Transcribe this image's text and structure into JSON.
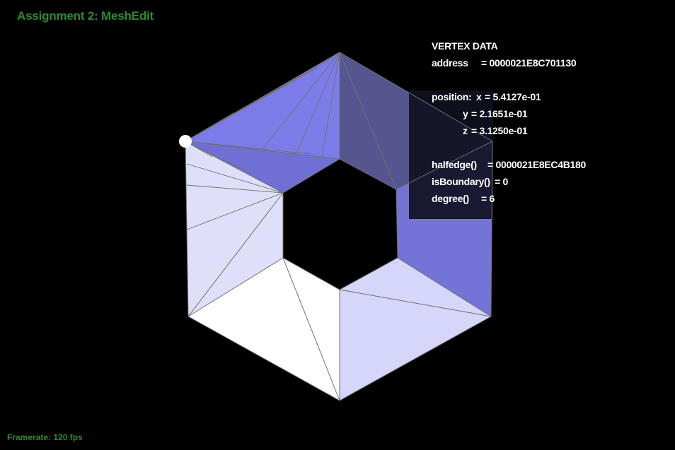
{
  "app": {
    "title": "Assignment 2: MeshEdit",
    "framerate_label": "Framerate:",
    "framerate_value": "120 fps"
  },
  "vertex_panel": {
    "heading": "VERTEX DATA",
    "address_label": "address",
    "address_value": "= 0000021E8C701130",
    "position_label": "position:",
    "x_label": "x",
    "x_value": "= 5.4127e-01",
    "y_label": "y",
    "y_value": "= 2.1651e-01",
    "z_label": "z",
    "z_value": "= 3.1250e-01",
    "halfedge_label": "halfedge()",
    "halfedge_value": "= 0000021E8EC4B180",
    "isboundary_label": "isBoundary()",
    "isboundary_value": "= 0",
    "degree_label": "degree()",
    "degree_value": "= 6"
  },
  "colors": {
    "background": "#000000",
    "title_green": "#2f8a2f",
    "selected_vertex": "#ffffff",
    "mesh_edge": "#6f6f6f"
  }
}
